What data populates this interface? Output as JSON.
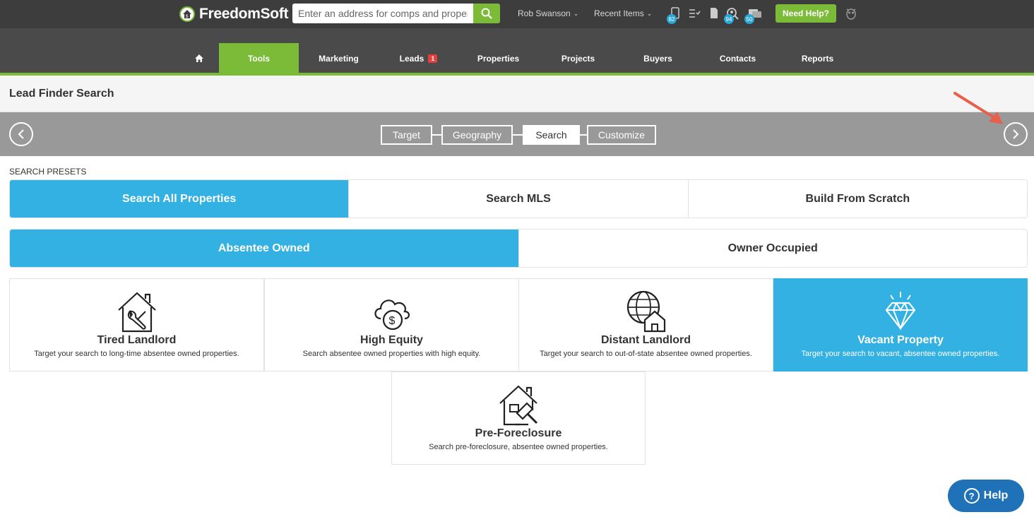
{
  "topbar": {
    "brand": "FreedomSoft",
    "search_placeholder": "Enter an address for comps and property info",
    "user_name": "Rob Swanson",
    "recent_items": "Recent Items",
    "badges": {
      "phone": "82",
      "search": "94",
      "chat": "50"
    },
    "need_help": "Need Help?"
  },
  "nav": {
    "items": [
      {
        "label": "Tools"
      },
      {
        "label": "Marketing"
      },
      {
        "label": "Leads",
        "badge": "1"
      },
      {
        "label": "Properties"
      },
      {
        "label": "Projects"
      },
      {
        "label": "Buyers"
      },
      {
        "label": "Contacts"
      },
      {
        "label": "Reports"
      }
    ]
  },
  "page": {
    "title": "Lead Finder Search"
  },
  "wizard": {
    "steps": [
      {
        "label": "Target"
      },
      {
        "label": "Geography"
      },
      {
        "label": "Search"
      },
      {
        "label": "Customize"
      }
    ],
    "current_step": "Search"
  },
  "presets": {
    "label": "SEARCH PRESETS",
    "scope": [
      {
        "label": "Search All Properties",
        "selected": true
      },
      {
        "label": "Search MLS",
        "selected": false
      },
      {
        "label": "Build From Scratch",
        "selected": false
      }
    ],
    "occupancy": [
      {
        "label": "Absentee Owned",
        "selected": true
      },
      {
        "label": "Owner Occupied",
        "selected": false
      }
    ],
    "cards": [
      {
        "title": "Tired Landlord",
        "desc": "Target your search to long-time absentee owned properties.",
        "icon": "house-wrench-icon",
        "selected": false
      },
      {
        "title": "High Equity",
        "desc": "Search absentee owned properties with high equity.",
        "icon": "cloud-dollar-icon",
        "selected": false
      },
      {
        "title": "Distant Landlord",
        "desc": "Target your search to out-of-state absentee owned properties.",
        "icon": "globe-house-icon",
        "selected": false
      },
      {
        "title": "Vacant Property",
        "desc": "Target your search to vacant, absentee owned properties.",
        "icon": "diamond-icon",
        "selected": true
      },
      {
        "title": "Pre-Foreclosure",
        "desc": "Search pre-foreclosure, absentee owned properties.",
        "icon": "house-gavel-icon",
        "selected": false
      }
    ]
  },
  "help": {
    "label": "Help"
  },
  "colors": {
    "accent_green": "#7cbb38",
    "accent_blue": "#33b1e3",
    "help_blue": "#1f71b8"
  }
}
